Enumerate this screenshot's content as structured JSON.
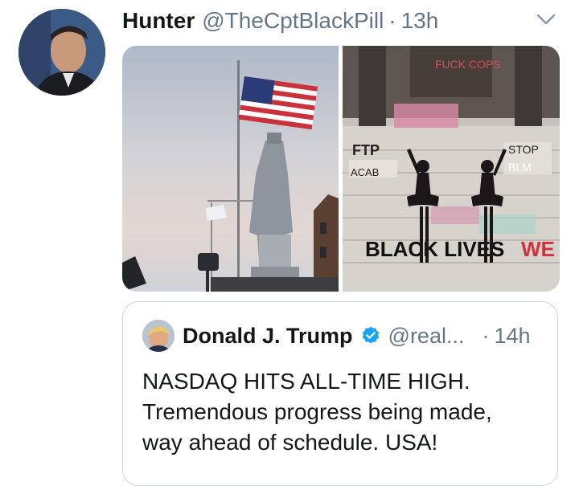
{
  "tweet": {
    "author_name": "Hunter",
    "author_handle": "@TheCptBlackPill",
    "separator": "·",
    "time": "13h",
    "avatar_icon": "user-avatar-photo",
    "menu_icon": "chevron-down-icon",
    "media": [
      {
        "icon": "photo-headless-statue-with-flag"
      },
      {
        "icon": "photo-dancers-graffiti-monument"
      }
    ],
    "media_text": [
      "FUCK COPS",
      "FTP",
      "ACAB",
      "STOP",
      "BLACK LIVES MATTER",
      "BLM"
    ]
  },
  "quote": {
    "author_name": "Donald J. Trump",
    "verified_icon": "verified-badge-icon",
    "author_handle": "@real...",
    "separator": "·",
    "time": "14h",
    "text": "NASDAQ HITS ALL-TIME HIGH.\nTremendous progress being made,\nway ahead of schedule. USA!"
  },
  "colors": {
    "text_primary": "#14171a",
    "text_secondary": "#657786",
    "verified_blue": "#1da1f2",
    "border": "#ccd6dd"
  }
}
